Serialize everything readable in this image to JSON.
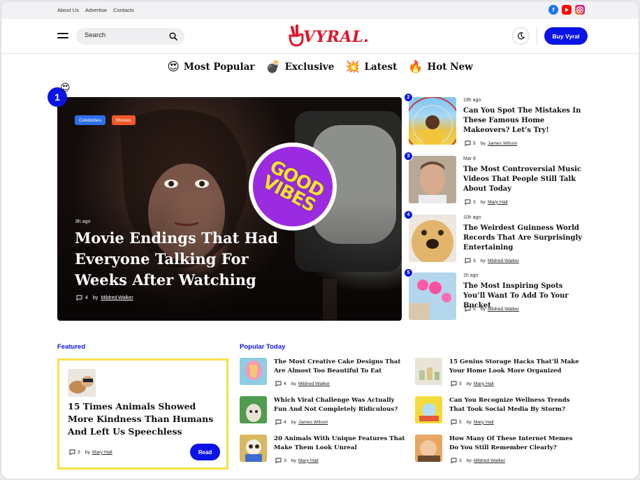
{
  "topbar": {
    "links": [
      "About Us",
      "Advertise",
      "Contacts"
    ],
    "socials": [
      "facebook-icon",
      "youtube-icon",
      "instagram-icon"
    ]
  },
  "header": {
    "search_placeholder": "Search",
    "logo": "VYRAL.",
    "buy_label": "Buy Vyral"
  },
  "nav": [
    {
      "emoji": "😍",
      "label": "Most Popular"
    },
    {
      "emoji": "💣",
      "label": "Exclusive"
    },
    {
      "emoji": "💥",
      "label": "Latest"
    },
    {
      "emoji": "🔥",
      "label": "Hot New"
    }
  ],
  "hero": {
    "rank": "1",
    "rank_emoji": "😍",
    "tags": [
      "Celebrities",
      "Movies"
    ],
    "time": "8h ago",
    "title": "Movie Endings That Had Everyone Talking For Weeks After Watching",
    "comments": "4",
    "by": "by",
    "author": "Mildred Walker",
    "sticker": [
      "GOOD",
      "VIBES"
    ]
  },
  "side": [
    {
      "rank": "2",
      "time": "19h ago",
      "title": "Can You Spot The Mistakes In These Famous Home Makeovers? Let’s Try!",
      "comments": "5",
      "by": "by",
      "author": "James Wilson"
    },
    {
      "rank": "3",
      "time": "Mar 8",
      "title": "The Most Controversial Music Videos That People Still Talk About Today",
      "comments": "3",
      "by": "by",
      "author": "Mary Hall"
    },
    {
      "rank": "4",
      "time": "10h ago",
      "title": "The Weirdest Guinness World Records That Are Surprisingly Entertaining",
      "comments": "3",
      "by": "by",
      "author": "Mildred Walker"
    },
    {
      "rank": "5",
      "time": "1h ago",
      "title": "The Most Inspiring Spots You’ll Want To Add To Your Bucket",
      "comments": "5",
      "by": "by",
      "author": "Mildred Walker"
    }
  ],
  "featured": {
    "label": "Featured",
    "title": "15 Times Animals Showed More Kindness Than Humans And Left Us Speechless",
    "comments": "3",
    "by": "by",
    "author": "Mary Hall",
    "read_label": "Read"
  },
  "popular": {
    "label": "Popular Today",
    "items": [
      {
        "title": "The Most Creative Cake Designs That Are Almost Too Beautiful To Eat",
        "comments": "4",
        "by": "by",
        "author": "Mildred Walker"
      },
      {
        "title": "15 Genius Storage Hacks That’ll Make Your Home Look More Organized",
        "comments": "3",
        "by": "by",
        "author": "Mary Hall"
      },
      {
        "title": "Which Viral Challenge Was Actually Fun And Not Completely Ridiculous?",
        "comments": "4",
        "by": "by",
        "author": "James Wilson"
      },
      {
        "title": "Can You Recognize Wellness Trends That Took Social Media By Storm?",
        "comments": "5",
        "by": "by",
        "author": "Mary Hall"
      },
      {
        "title": "20 Animals With Unique Features That Make Them Look Unreal",
        "comments": "3",
        "by": "by",
        "author": "Mary Hall"
      },
      {
        "title": "How Many Of These Internet Memes Do You Still Remember Clearly?",
        "comments": "3",
        "by": "by",
        "author": "Mildred Walker"
      }
    ]
  },
  "colors": {
    "accent": "#0a14e6",
    "logo": "#e0162b",
    "featured_border": "#f4e34a"
  }
}
